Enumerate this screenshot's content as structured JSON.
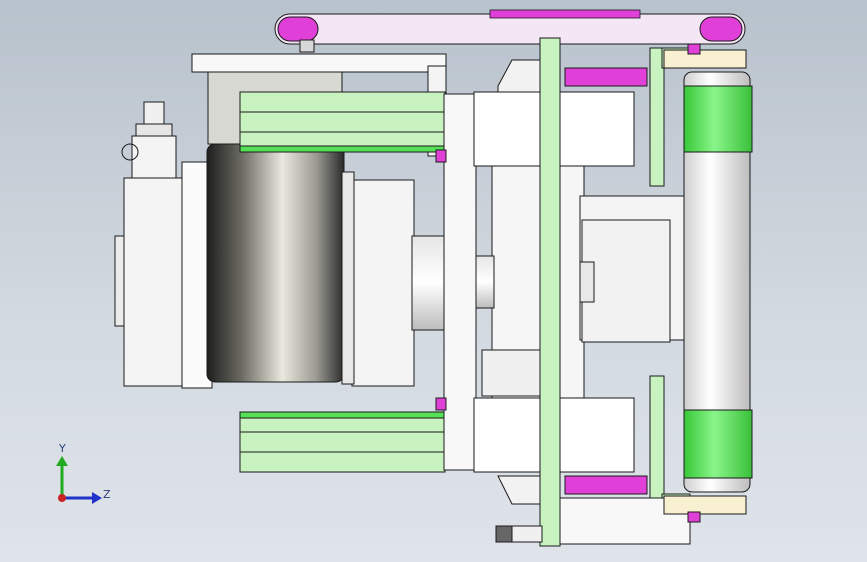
{
  "triad": {
    "y_label": "Y",
    "z_label": "Z"
  },
  "colors": {
    "green_part": "#c8f2c0",
    "green_bright": "#55e055",
    "magenta_part": "#e040d8",
    "steel_light": "#f4f4f4",
    "steel_edge": "#1a1a1a",
    "motor_dark": "#2a2a2a",
    "axis_y": "#22aa22",
    "axis_z": "#2233cc",
    "axis_origin": "#cc2222"
  }
}
